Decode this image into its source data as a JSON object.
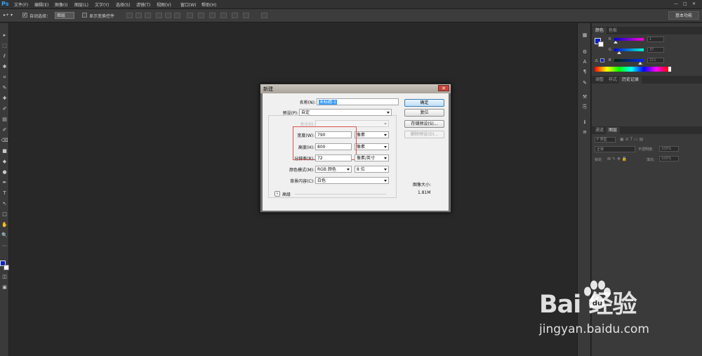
{
  "app": {
    "logo": "Ps"
  },
  "menubar": {
    "items": [
      "文件(F)",
      "编辑(E)",
      "图像(I)",
      "图层(L)",
      "文字(Y)",
      "选择(S)",
      "滤镜(T)",
      "视图(V)",
      "窗口(W)",
      "帮助(H)"
    ],
    "window_controls": [
      "—",
      "□",
      "✕"
    ]
  },
  "optionsbar": {
    "auto_select_label": "自动选择：",
    "auto_select_value": "图层",
    "show_transform_label": "显示变换控件",
    "workspace": "基本功能"
  },
  "tools": [
    "▸",
    "⬚",
    "ℓ",
    "✱",
    "⌗",
    "✎",
    "✚",
    "✐",
    "▤",
    "✐",
    "⌫",
    "■",
    "◆",
    "●",
    "✒",
    "T",
    "↖",
    "□",
    "✋",
    "🔍",
    "⋯"
  ],
  "right_panel": {
    "color_tabs": [
      "颜色",
      "色板"
    ],
    "color_rows": [
      {
        "label": "R",
        "value": "1"
      },
      {
        "label": "G",
        "value": "37"
      },
      {
        "label": "B",
        "value": "211"
      }
    ],
    "adjust_tabs": [
      "调整",
      "样式",
      "历史记录"
    ],
    "layers_tabs": [
      "通道",
      "图层"
    ],
    "layers_kind": "P 类型",
    "blend_mode": "正常",
    "opacity_label": "不透明度:",
    "opacity_value": "100%",
    "lock_label": "锁定:",
    "fill_label": "填充:",
    "fill_value": "100%",
    "colors": {
      "fg": "#0a22c8",
      "bg": "#ffffff"
    }
  },
  "dialog": {
    "title": "新建",
    "name_label": "名称(N):",
    "name_value": "未标题-1",
    "preset_label": "预设(P):",
    "preset_value": "自定",
    "size_label": "大小(I):",
    "size_value": "",
    "width_label": "宽度(W):",
    "width_value": "790",
    "width_unit": "像素",
    "height_label": "高度(H):",
    "height_value": "800",
    "height_unit": "像素",
    "resolution_label": "分辨率(R):",
    "resolution_value": "72",
    "resolution_unit": "像素/英寸",
    "color_mode_label": "颜色模式(M):",
    "color_mode_value": "RGB 颜色",
    "bit_depth_value": "8 位",
    "background_label": "背景内容(C):",
    "background_value": "白色",
    "advanced_label": "高级",
    "buttons": {
      "ok": "确定",
      "reset": "复位",
      "save_preset": "存储预设(S)...",
      "delete_preset": "删除预设(D)..."
    },
    "image_size_label": "图像大小:",
    "image_size_value": "1.81M",
    "close_glyph": "✕"
  },
  "watermark": {
    "logo": "Bai  经验",
    "url": "jingyan.baidu.com"
  }
}
